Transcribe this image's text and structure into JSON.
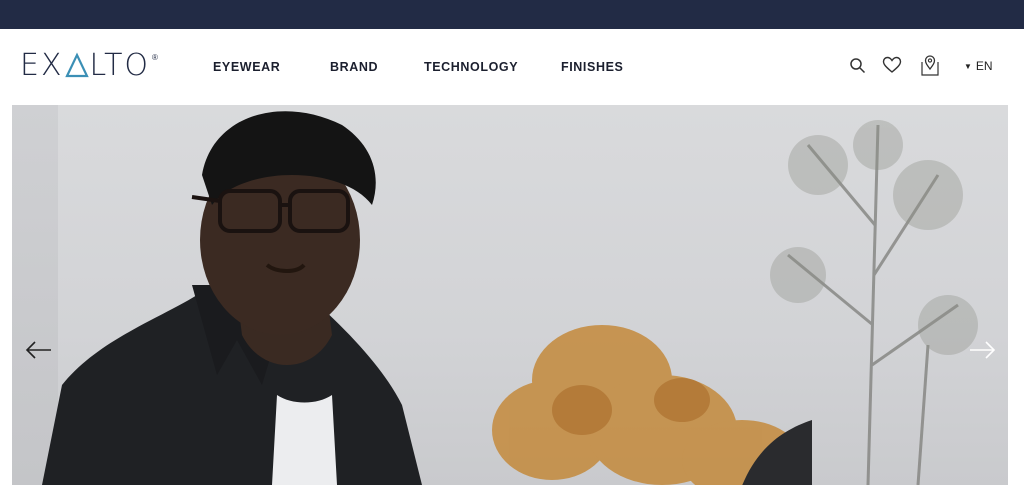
{
  "brand": {
    "logo_text": "EXALTO",
    "registered_mark": "®"
  },
  "nav": {
    "items": [
      {
        "label": "EYEWEAR"
      },
      {
        "label": "BRAND"
      },
      {
        "label": "TECHNOLOGY"
      },
      {
        "label": "FINISHES"
      }
    ]
  },
  "tools": {
    "icons": [
      "search-icon",
      "heart-icon",
      "store-locator-icon"
    ],
    "language": "EN"
  },
  "hero": {
    "icons": [
      "arrow-left-icon",
      "arrow-right-icon"
    ]
  },
  "colors": {
    "topbar": "#222b45",
    "logo": "#222b45",
    "logo_accent": "#3b8fb5"
  }
}
